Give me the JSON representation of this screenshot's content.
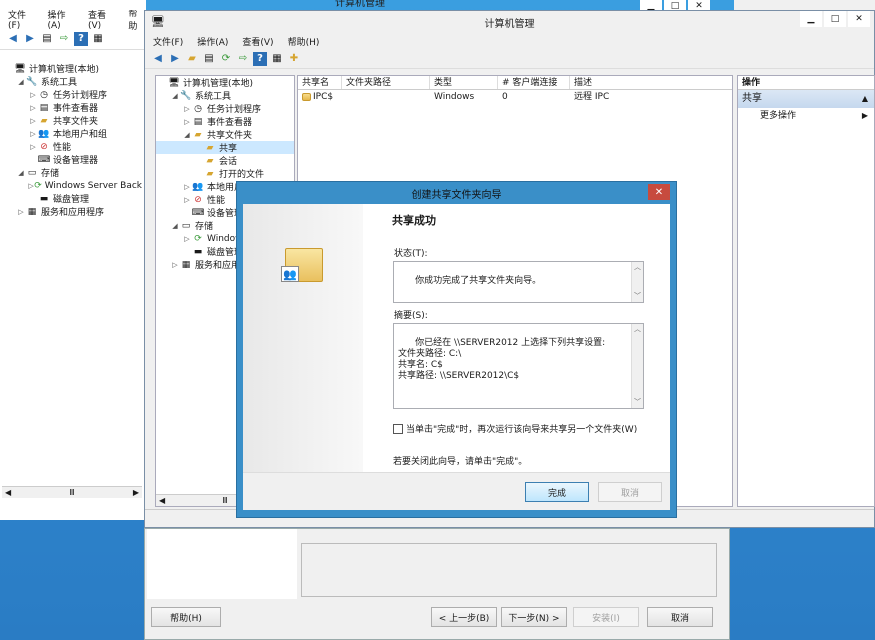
{
  "back_window": {
    "title": "计算机管理",
    "menu": [
      "文件(F)",
      "操作(A)",
      "查看(V)",
      "帮助"
    ],
    "tree": [
      {
        "label": "计算机管理(本地)",
        "level": 0,
        "arrow": "",
        "icon": "computer-icon"
      },
      {
        "label": "系统工具",
        "level": 1,
        "arrow": "◢",
        "icon": "tools-icon"
      },
      {
        "label": "任务计划程序",
        "level": 2,
        "arrow": "▷",
        "icon": "clock-icon"
      },
      {
        "label": "事件查看器",
        "level": 2,
        "arrow": "▷",
        "icon": "event-viewer-icon"
      },
      {
        "label": "共享文件夹",
        "level": 2,
        "arrow": "▷",
        "icon": "shared-folder-icon"
      },
      {
        "label": "本地用户和组",
        "level": 2,
        "arrow": "▷",
        "icon": "users-icon"
      },
      {
        "label": "性能",
        "level": 2,
        "arrow": "▷",
        "icon": "performance-icon"
      },
      {
        "label": "设备管理器",
        "level": 2,
        "arrow": "",
        "icon": "device-manager-icon"
      },
      {
        "label": "存储",
        "level": 1,
        "arrow": "◢",
        "icon": "storage-icon"
      },
      {
        "label": "Windows Server Back",
        "level": 2,
        "arrow": "▷",
        "icon": "backup-icon"
      },
      {
        "label": "磁盘管理",
        "level": 2,
        "arrow": "",
        "icon": "disk-icon"
      },
      {
        "label": "服务和应用程序",
        "level": 1,
        "arrow": "▷",
        "icon": "services-icon"
      }
    ]
  },
  "main_window": {
    "title": "计算机管理",
    "menu": [
      "文件(F)",
      "操作(A)",
      "查看(V)",
      "帮助(H)"
    ],
    "tree": [
      {
        "label": "计算机管理(本地)",
        "level": 0,
        "arrow": "",
        "icon": "computer-icon"
      },
      {
        "label": "系统工具",
        "level": 1,
        "arrow": "◢",
        "icon": "tools-icon"
      },
      {
        "label": "任务计划程序",
        "level": 2,
        "arrow": "▷",
        "icon": "clock-icon"
      },
      {
        "label": "事件查看器",
        "level": 2,
        "arrow": "▷",
        "icon": "event-viewer-icon"
      },
      {
        "label": "共享文件夹",
        "level": 2,
        "arrow": "◢",
        "icon": "shared-folder-icon"
      },
      {
        "label": "共享",
        "level": 3,
        "arrow": "",
        "icon": "share-icon",
        "selected": true
      },
      {
        "label": "会话",
        "level": 3,
        "arrow": "",
        "icon": "session-icon"
      },
      {
        "label": "打开的文件",
        "level": 3,
        "arrow": "",
        "icon": "open-file-icon"
      },
      {
        "label": "本地用户",
        "level": 2,
        "arrow": "▷",
        "icon": "users-icon"
      },
      {
        "label": "性能",
        "level": 2,
        "arrow": "▷",
        "icon": "performance-icon"
      },
      {
        "label": "设备管理",
        "level": 2,
        "arrow": "",
        "icon": "device-manager-icon"
      },
      {
        "label": "存储",
        "level": 1,
        "arrow": "◢",
        "icon": "storage-icon"
      },
      {
        "label": "Window",
        "level": 2,
        "arrow": "▷",
        "icon": "backup-icon"
      },
      {
        "label": "磁盘管理",
        "level": 2,
        "arrow": "",
        "icon": "disk-icon"
      },
      {
        "label": "服务和应用程",
        "level": 1,
        "arrow": "▷",
        "icon": "services-icon"
      }
    ],
    "columns": [
      "共享名",
      "文件夹路径",
      "类型",
      "# 客户端连接",
      "描述"
    ],
    "rows": [
      {
        "name": "IPC$",
        "path": "",
        "type": "Windows",
        "clients": "0",
        "desc": "远程 IPC"
      }
    ],
    "actions": {
      "header": "操作",
      "section": "共享",
      "more": "更多操作"
    }
  },
  "under_wizard": {
    "help": "帮助(H)",
    "prev": "< 上一步(B)",
    "next": "下一步(N) >",
    "install": "安装(I)",
    "cancel": "取消"
  },
  "dialog": {
    "title": "创建共享文件夹向导",
    "heading": "共享成功",
    "status_label": "状态(T):",
    "status_text": "你成功完成了共享文件夹向导。",
    "summary_label": "摘要(S):",
    "summary_text": "你已经在 \\\\SERVER2012 上选择下列共享设置:\n文件夹路径: C:\\\n共享名: C$\n共享路径: \\\\SERVER2012\\C$",
    "checkbox_label": "当单击\"完成\"时，再次运行该向导来共享另一个文件夹(W)",
    "footer_text": "若要关闭此向导，请单击\"完成\"。",
    "finish": "完成",
    "cancel": "取消"
  },
  "colors": {
    "desktop": "#2f86cf",
    "dialog_border": "#3a8fc8",
    "close_red": "#c74b3e",
    "selection": "#cce8ff"
  }
}
